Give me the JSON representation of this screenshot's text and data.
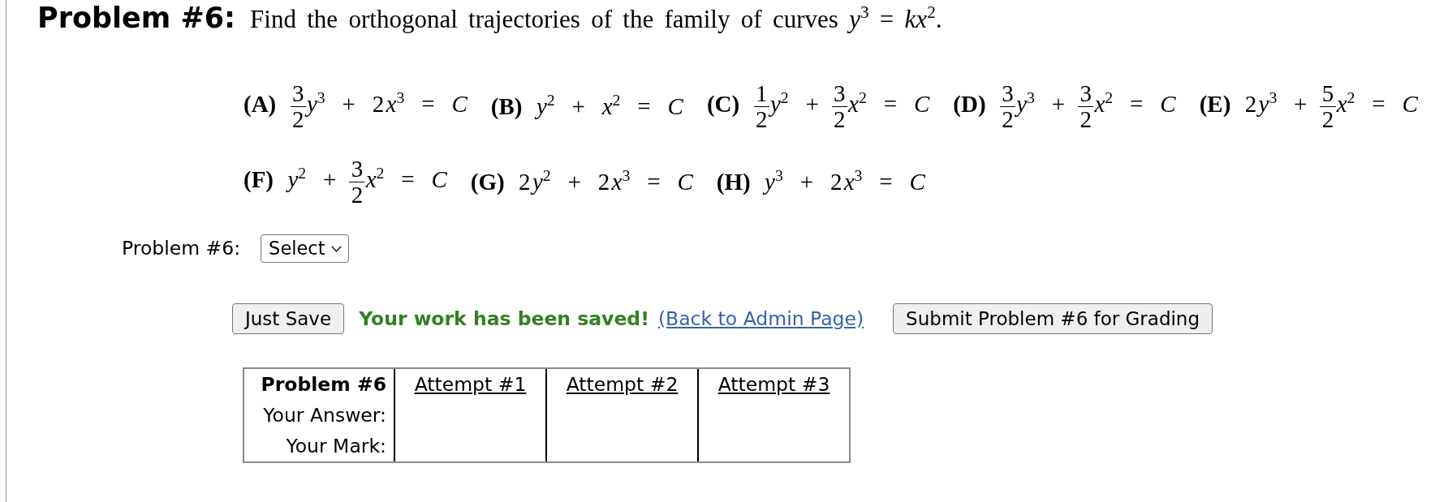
{
  "problem": {
    "heading": "Problem #6:",
    "question": "Find the orthogonal trajectories of the family of curves *y*$^{3}$ = *kx*$^{2}$."
  },
  "option_rows": [
    [
      {
        "label": "(A)",
        "expression": [
          {
            "kind": "frac",
            "num": "3",
            "den": "2"
          },
          {
            "kind": "text",
            "text": "*y*$^{3}$ + 2"
          },
          {
            "kind": "text",
            "text": "*x*$^{3}$ = *C*"
          }
        ]
      },
      {
        "label": "(B)",
        "expression": [
          {
            "kind": "text",
            "text": "*y*$^{2}$ + *x*$^{2}$ = *C*"
          }
        ]
      },
      {
        "label": "(C)",
        "expression": [
          {
            "kind": "frac",
            "num": "1",
            "den": "2"
          },
          {
            "kind": "text",
            "text": "*y*$^{2}$ +"
          },
          {
            "kind": "frac",
            "num": "3",
            "den": "2"
          },
          {
            "kind": "text",
            "text": "*x*$^{2}$ = *C*"
          }
        ]
      },
      {
        "label": "(D)",
        "expression": [
          {
            "kind": "frac",
            "num": "3",
            "den": "2"
          },
          {
            "kind": "text",
            "text": "*y*$^{3}$ +"
          },
          {
            "kind": "frac",
            "num": "3",
            "den": "2"
          },
          {
            "kind": "text",
            "text": "*x*$^{2}$ = *C*"
          }
        ]
      },
      {
        "label": "(E)",
        "expression": [
          {
            "kind": "text",
            "text": "2"
          },
          {
            "kind": "text",
            "text": "*y*$^{3}$ +"
          },
          {
            "kind": "frac",
            "num": "5",
            "den": "2"
          },
          {
            "kind": "text",
            "text": "*x*$^{2}$ = *C*"
          }
        ]
      }
    ],
    [
      {
        "label": "(F)",
        "expression": [
          {
            "kind": "text",
            "text": "*y*$^{2}$ +"
          },
          {
            "kind": "frac",
            "num": "3",
            "den": "2"
          },
          {
            "kind": "text",
            "text": "*x*$^{2}$ = *C*"
          }
        ]
      },
      {
        "label": "(G)",
        "expression": [
          {
            "kind": "text",
            "text": "2"
          },
          {
            "kind": "text",
            "text": "*y*$^{2}$ + 2"
          },
          {
            "kind": "text",
            "text": "*x*$^{3}$ = *C*"
          }
        ]
      },
      {
        "label": "(H)",
        "expression": [
          {
            "kind": "text",
            "text": "*y*$^{3}$ + 2"
          },
          {
            "kind": "text",
            "text": "*x*$^{3}$ = *C*"
          }
        ]
      }
    ]
  ],
  "answer": {
    "label": "Problem #6:",
    "select": "Select"
  },
  "actions": {
    "save_button": "Just Save",
    "saved_message": "Your work has been saved!",
    "admin_link": "(Back to Admin Page)",
    "submit_button": "Submit Problem #6 for Grading"
  },
  "attempts_table": {
    "corner": "Problem #6",
    "columns": [
      "Attempt #1",
      "Attempt #2",
      "Attempt #3"
    ],
    "rows": [
      "Your Answer:",
      "Your Mark:"
    ]
  }
}
